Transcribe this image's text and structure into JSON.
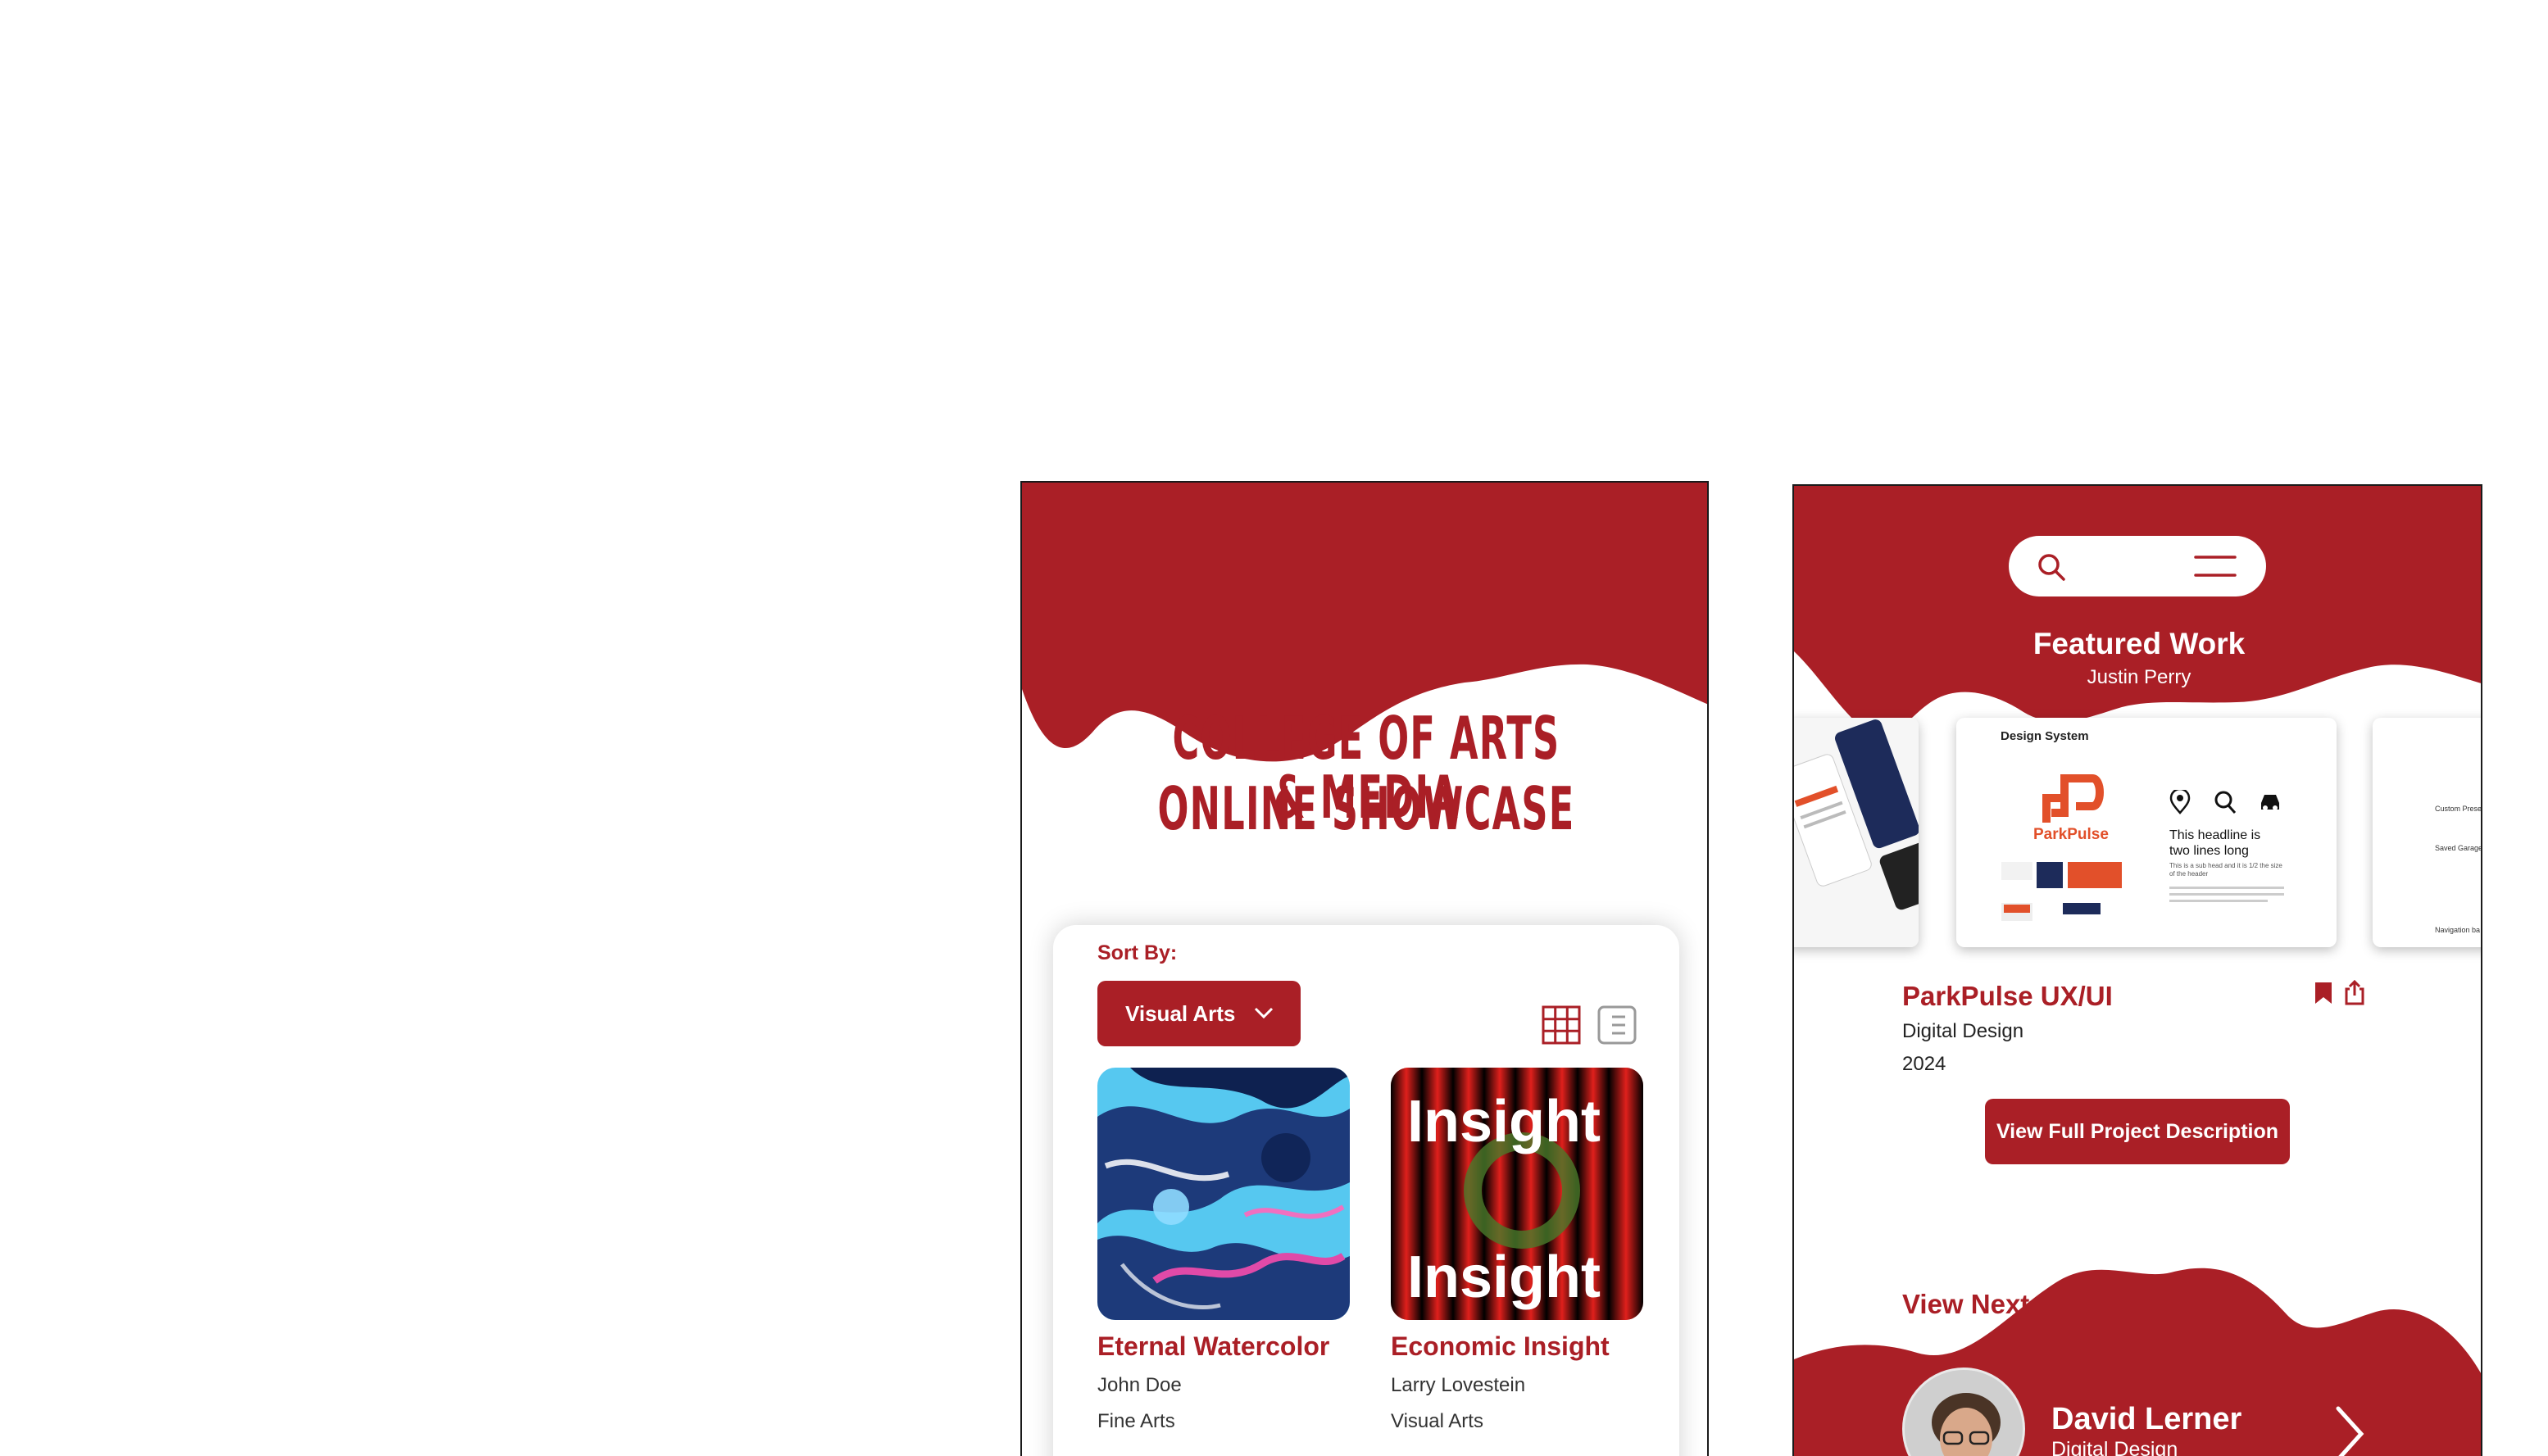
{
  "colors": {
    "brand_red": "#aa1f26",
    "white": "#ffffff",
    "text_gray": "#333333"
  },
  "showcase": {
    "title_line1": "COLLEGE OF ARTS & MEDIA",
    "title_line2": "ONLINE SHOWCASE",
    "sort_label": "Sort By:",
    "sort_value": "Visual Arts",
    "view_icons": [
      "grid-view-icon",
      "list-view-icon"
    ],
    "artworks": [
      {
        "title": "Eternal Watercolor",
        "artist": "John Doe",
        "category": "Fine Arts"
      },
      {
        "title": "Economic Insight",
        "artist": "Larry Lovestein",
        "category": "Visual Arts",
        "poster_word1": "Insight",
        "poster_word2": "Insight"
      }
    ]
  },
  "detail": {
    "header_icons": [
      "search-icon",
      "menu-icon"
    ],
    "featured_title": "Featured Work",
    "featured_author": "Justin Perry",
    "slide": {
      "heading": "Design System",
      "brand": "ParkPulse",
      "headline": "This headline is two lines long",
      "subhead": "This is a sub head and it is 1/2 the size of the header",
      "side_labels": [
        "Custom Prese",
        "Saved Garage",
        "Navigation ba"
      ]
    },
    "project_title": "ParkPulse UX/UI",
    "project_category": "Digital Design",
    "project_year": "2024",
    "action_icons": [
      "bookmark-icon",
      "share-icon"
    ],
    "cta_label": "View Full Project Description",
    "view_next_label": "View Next",
    "next_name": "David Lerner",
    "next_category": "Digital Design"
  }
}
